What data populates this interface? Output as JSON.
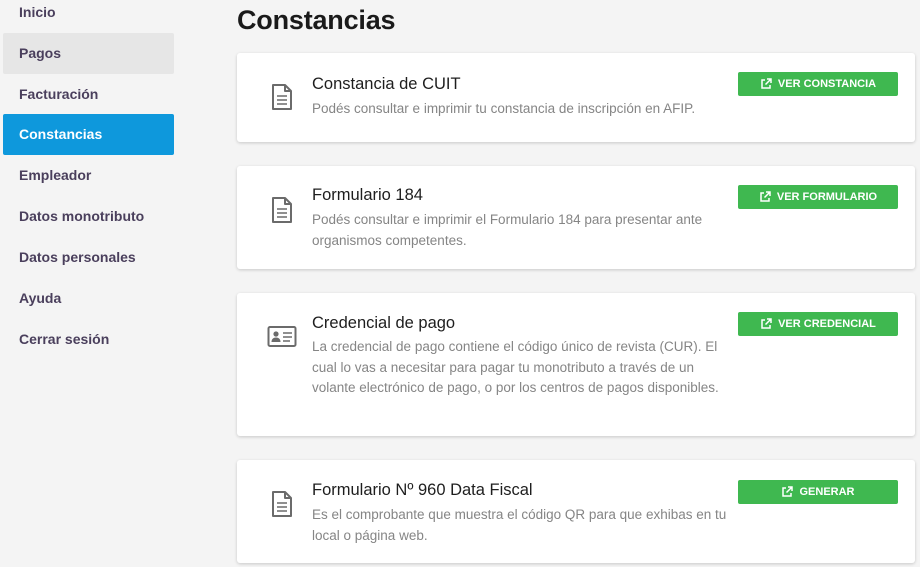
{
  "sidebar": {
    "items": [
      {
        "label": "Inicio"
      },
      {
        "label": "Pagos"
      },
      {
        "label": "Facturación"
      },
      {
        "label": "Constancias"
      },
      {
        "label": "Empleador"
      },
      {
        "label": "Datos monotributo"
      },
      {
        "label": "Datos personales"
      },
      {
        "label": "Ayuda"
      },
      {
        "label": "Cerrar sesión"
      }
    ],
    "active": "Constancias",
    "hovered": "Pagos"
  },
  "main": {
    "title": "Constancias",
    "cards": [
      {
        "icon": "document-icon",
        "title": "Constancia de CUIT",
        "description": "Podés consultar e imprimir tu constancia de inscripción en AFIP.",
        "button": "VER CONSTANCIA"
      },
      {
        "icon": "document-icon",
        "title": "Formulario 184",
        "description": "Podés consultar e imprimir el Formulario 184 para presentar ante organismos competentes.",
        "button": "VER FORMULARIO"
      },
      {
        "icon": "id-card-icon",
        "title": "Credencial de pago",
        "description": "La credencial de pago contiene el código único de revista (CUR). El cual lo vas a necesitar para pagar tu monotributo a través de un volante electrónico de pago, o por los centros de pagos disponibles.",
        "button": "VER CREDENCIAL"
      },
      {
        "icon": "document-icon",
        "title": "Formulario Nº 960 Data Fiscal",
        "description": "Es el comprobante que muestra el código QR para que exhibas en tu local o página web.",
        "button": "GENERAR"
      }
    ]
  },
  "colors": {
    "active_nav": "#0e98dc",
    "button": "#3fb850",
    "background": "#f4f4f4"
  }
}
